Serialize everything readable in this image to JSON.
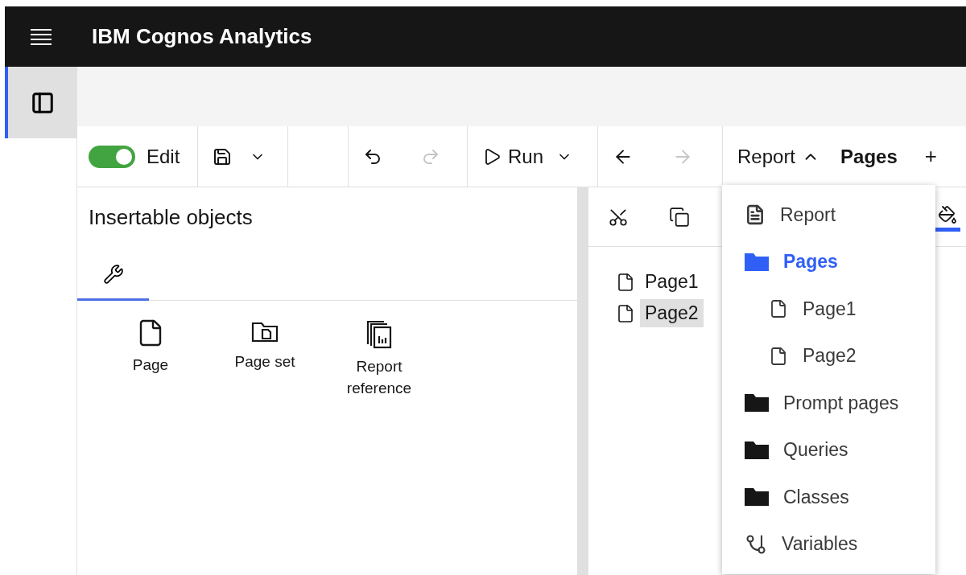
{
  "header": {
    "title": "IBM Cognos Analytics"
  },
  "rail": {
    "panel_toggle": {
      "selected": true
    }
  },
  "toolbar": {
    "edit_toggle": {
      "label": "Edit",
      "on": true
    },
    "undo": {
      "disabled": false
    },
    "redo": {
      "disabled": true
    },
    "run": {
      "label": "Run"
    },
    "back": {
      "disabled": false
    },
    "forward": {
      "disabled": true
    },
    "breadcrumb": {
      "label": "Report",
      "expanded": true
    },
    "current": "Pages",
    "add": "+"
  },
  "insertable_objects": {
    "title": "Insertable objects",
    "tabs": [
      {
        "selected": true
      }
    ],
    "items": [
      {
        "label": "Page",
        "kind": "page"
      },
      {
        "label": "Page set",
        "kind": "page-set"
      },
      {
        "label": "Report reference",
        "kind": "report-reference"
      }
    ]
  },
  "pages_panel": {
    "pages": [
      {
        "label": "Page1",
        "selected": false
      },
      {
        "label": "Page2",
        "selected": true
      }
    ]
  },
  "menu": {
    "items": [
      {
        "label": "Report",
        "kind": "report",
        "selected": false
      },
      {
        "label": "Pages",
        "kind": "folder",
        "selected": true,
        "children": [
          {
            "label": "Page1",
            "kind": "page",
            "selected": false
          },
          {
            "label": "Page2",
            "kind": "page",
            "selected": false
          }
        ]
      },
      {
        "label": "Prompt pages",
        "kind": "folder",
        "selected": false
      },
      {
        "label": "Queries",
        "kind": "folder",
        "selected": false
      },
      {
        "label": "Classes",
        "kind": "folder",
        "selected": false
      },
      {
        "label": "Variables",
        "kind": "variables",
        "selected": false
      }
    ]
  }
}
